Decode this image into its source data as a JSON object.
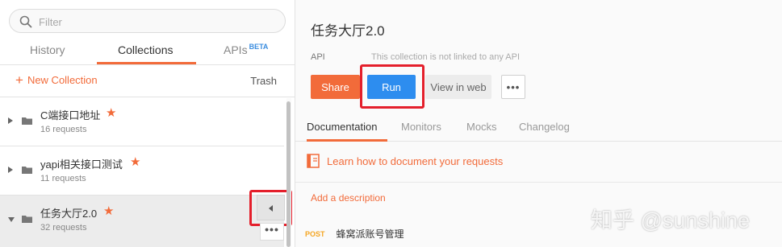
{
  "sidebar": {
    "filter_placeholder": "Filter",
    "tabs": [
      {
        "label": "History"
      },
      {
        "label": "Collections"
      },
      {
        "label": "APIs",
        "badge": "BETA"
      }
    ],
    "new_collection": "New Collection",
    "trash": "Trash",
    "collections": [
      {
        "name": "C端接口地址",
        "count": "16 requests"
      },
      {
        "name": "yapi相关接口测试",
        "count": "11 requests"
      },
      {
        "name": "任务大厅2.0",
        "count": "32 requests"
      }
    ],
    "more_label": "•••"
  },
  "main": {
    "title": "任务大厅2.0",
    "api_label": "API",
    "api_note": "This collection is not linked to any API",
    "buttons": {
      "share": "Share",
      "run": "Run",
      "view_in_web": "View in web",
      "more": "•••"
    },
    "tabs": [
      {
        "label": "Documentation"
      },
      {
        "label": "Monitors"
      },
      {
        "label": "Mocks"
      },
      {
        "label": "Changelog"
      }
    ],
    "learn_link": "Learn how to document your requests",
    "add_description": "Add a description",
    "requests": [
      {
        "method": "POST",
        "name": "蜂窝派账号管理"
      }
    ]
  },
  "watermark": "知乎 @sunshine",
  "colors": {
    "accent": "#f26b3a",
    "run_blue": "#2d8def",
    "highlight_red": "#e41f2b",
    "post_method": "#f5a623"
  }
}
